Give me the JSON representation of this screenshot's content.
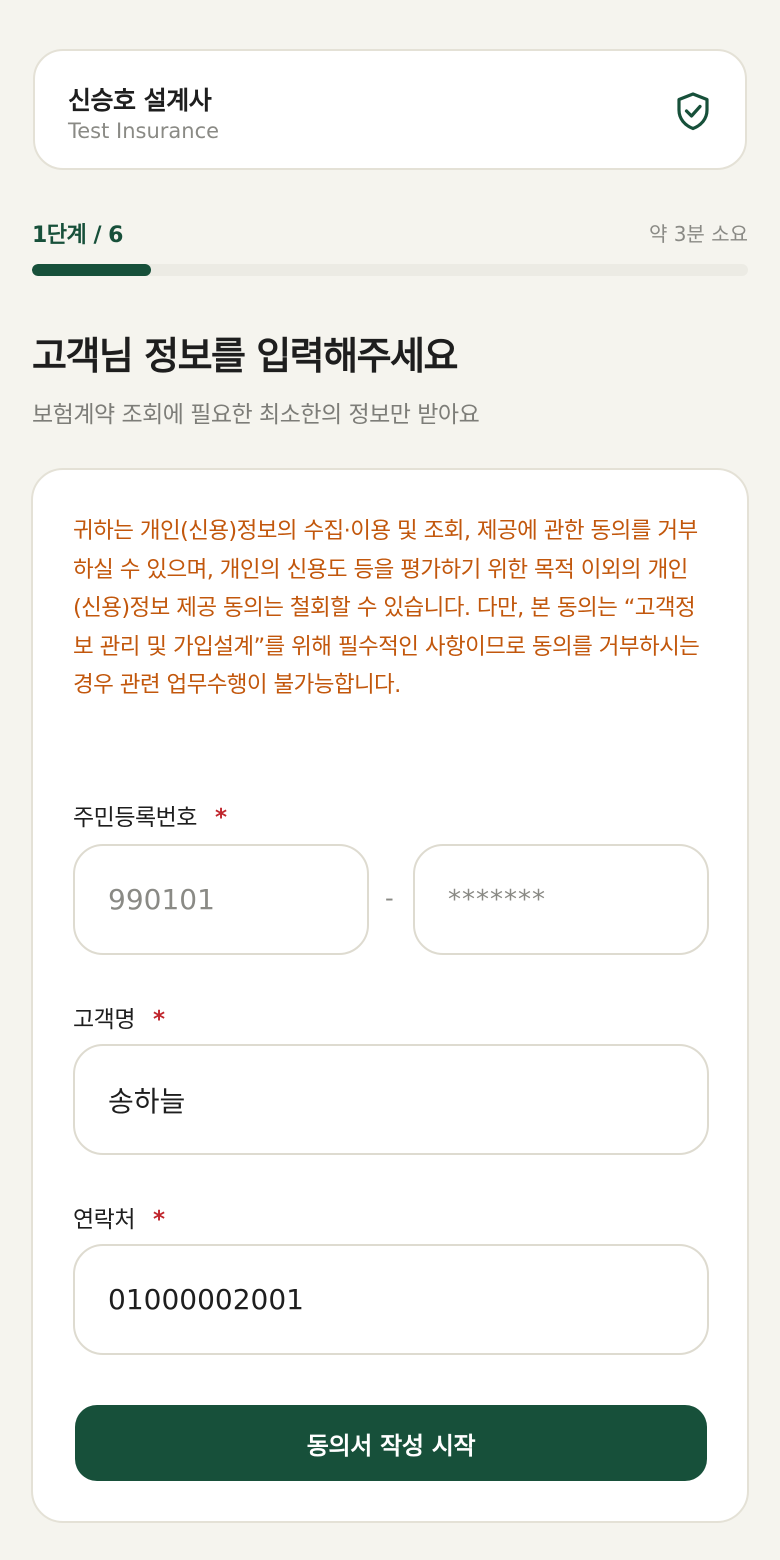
{
  "agent": {
    "name": "신승호 설계사",
    "company": "Test Insurance",
    "icon": "shield-check-icon"
  },
  "progress": {
    "step_label": "1단계 / 6",
    "time_estimate": "약 3분 소요",
    "current_step": 1,
    "total_steps": 6
  },
  "page": {
    "title": "고객님 정보를 입력해주세요",
    "subtitle": "보험계약 조회에 필요한 최소한의 정보만 받아요"
  },
  "form": {
    "notice": "귀하는 개인(신용)정보의 수집·이용 및 조회, 제공에 관한 동의를 거부하실 수 있으며, 개인의 신용도 등을 평가하기 위한 목적 이외의 개인(신용)정보 제공 동의는 철회할 수 있습니다. 다만, 본 동의는 “고객정보 관리 및 가입설계”를 위해 필수적인 사항이므로 동의를 거부하시는 경우 관련 업무수행이 불가능합니다.",
    "rrn": {
      "label": "주민등록번호",
      "required_mark": "*",
      "front_placeholder": "990101",
      "separator": "-",
      "back_placeholder": "*******"
    },
    "name": {
      "label": "고객명",
      "required_mark": "*",
      "value": "송하늘"
    },
    "phone": {
      "label": "연락처",
      "required_mark": "*",
      "value": "01000002001"
    },
    "submit_label": "동의서 작성 시작"
  },
  "colors": {
    "brand": "#17503a",
    "notice": "#c2570c",
    "required": "#c0262d",
    "background": "#f5f4ee"
  }
}
